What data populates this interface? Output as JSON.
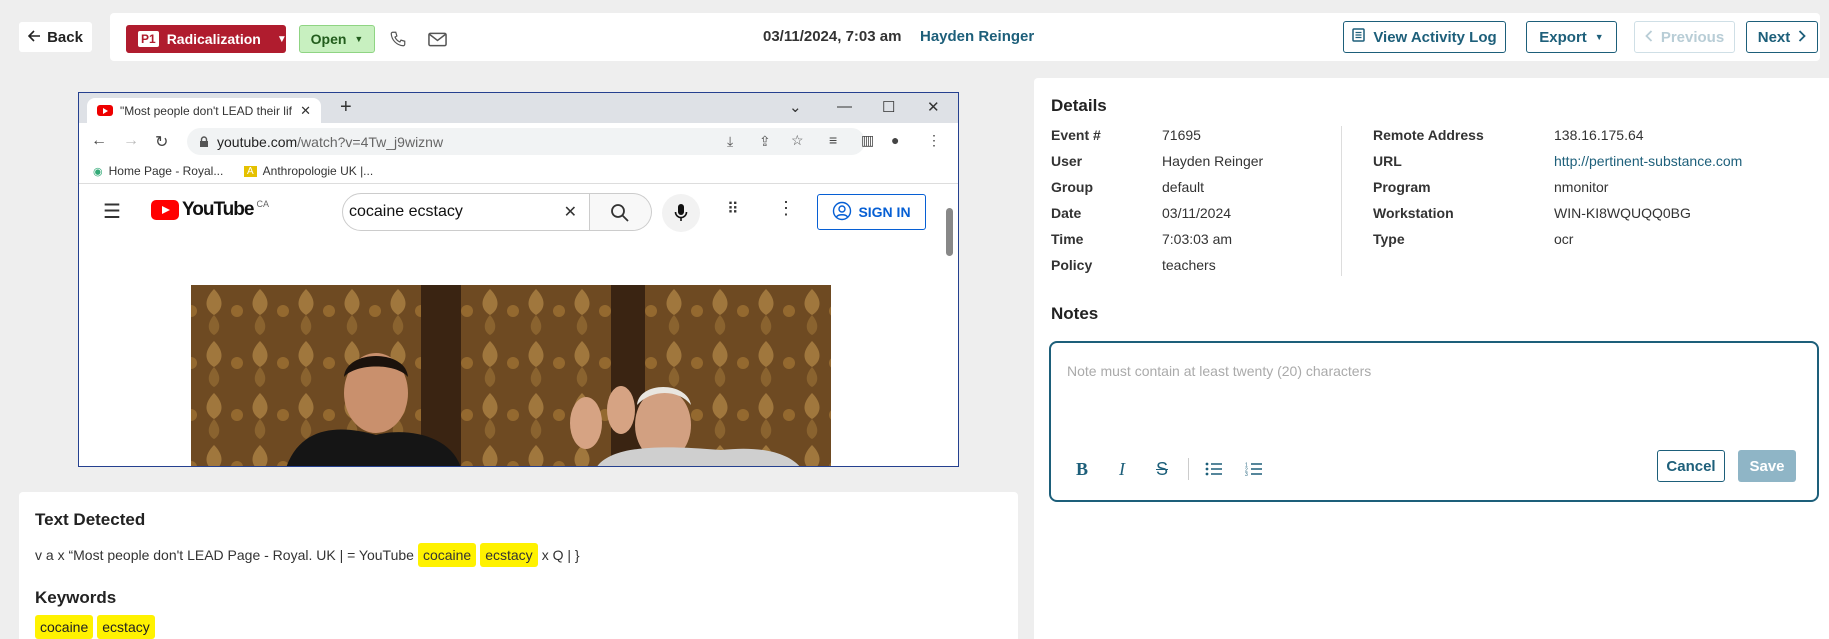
{
  "header": {
    "back_label": "Back",
    "priority_code": "P1",
    "priority_label": "Radicalization",
    "status_label": "Open",
    "datetime": "03/11/2024, 7:03 am",
    "user_name": "Hayden Reinger",
    "activity_log_label": "View Activity Log",
    "export_label": "Export",
    "previous_label": "Previous",
    "next_label": "Next"
  },
  "screenshot": {
    "tab_title": "\"Most people don't LEAD their lif",
    "url_host": "youtube.com",
    "url_path": "/watch?v=4Tw_j9wiznw",
    "bookmarks": [
      "Home Page - Royal...",
      "Anthropologie UK |..."
    ],
    "yt_logo": "YouTube",
    "yt_region": "CA",
    "yt_search_query": "cocaine ecstacy",
    "yt_signin_label": "SIGN IN"
  },
  "text_detected": {
    "title": "Text Detected",
    "before": "v a x “Most people don't LEAD Page - Royal. UK | = YouTube",
    "highlights": [
      "cocaine",
      "ecstacy"
    ],
    "after": "x Q | }"
  },
  "keywords": {
    "title": "Keywords",
    "items": [
      "cocaine",
      "ecstacy"
    ]
  },
  "details": {
    "title": "Details",
    "left": [
      {
        "key": "Event #",
        "value": "71695"
      },
      {
        "key": "User",
        "value": "Hayden Reinger"
      },
      {
        "key": "Group",
        "value": "default"
      },
      {
        "key": "Date",
        "value": "03/11/2024"
      },
      {
        "key": "Time",
        "value": "7:03:03 am"
      },
      {
        "key": "Policy",
        "value": "teachers"
      }
    ],
    "right": [
      {
        "key": "Remote Address",
        "value": "138.16.175.64"
      },
      {
        "key": "URL",
        "value": "http://pertinent-substance.com"
      },
      {
        "key": "Program",
        "value": "nmonitor"
      },
      {
        "key": "Workstation",
        "value": "WIN-KI8WQUQQ0BG"
      },
      {
        "key": "Type",
        "value": "ocr"
      }
    ]
  },
  "notes": {
    "title": "Notes",
    "placeholder": "Note must contain at least twenty (20) characters",
    "cancel_label": "Cancel",
    "save_label": "Save"
  },
  "colors": {
    "accent": "#1d5f7a",
    "priority": "#b01c2e",
    "status_bg": "#c8f0c0",
    "highlight": "#fff200"
  }
}
